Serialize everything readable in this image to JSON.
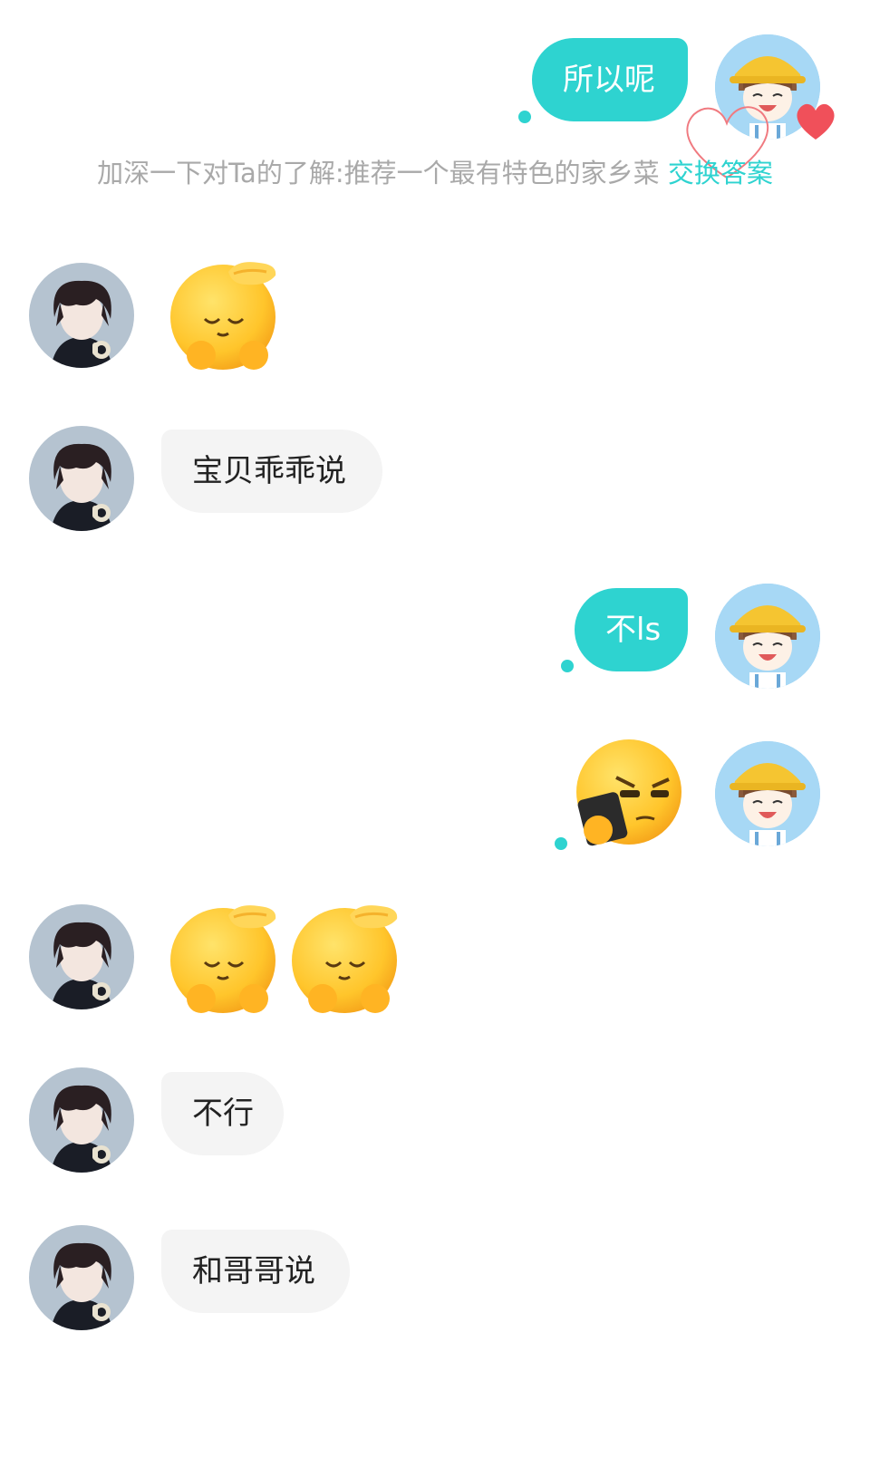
{
  "colors": {
    "accent": "#2ed3d0",
    "my_bubble": "#2ed3d0",
    "their_bubble": "#f4f4f4",
    "system_text": "#a9a9a9",
    "heart": "#f0505a"
  },
  "icons": {
    "my_avatar": "girl-yellow-hat-avatar",
    "their_avatar": "dark-haired-boy-avatar",
    "pat_head_emoji": "pat-head-emoji",
    "phone_side_eye_emoji": "side-eye-phone-emoji",
    "heart": "heart-icon"
  },
  "messages": {
    "m1_text": "所以呢",
    "system_prompt": "加深一下对Ta的了解:推荐一个最有特色的家乡菜",
    "system_link": "交换答案",
    "m3_text": "宝贝乖乖说",
    "m4_text": "不ls",
    "m7_text": "不行",
    "m8_text": "和哥哥说"
  }
}
